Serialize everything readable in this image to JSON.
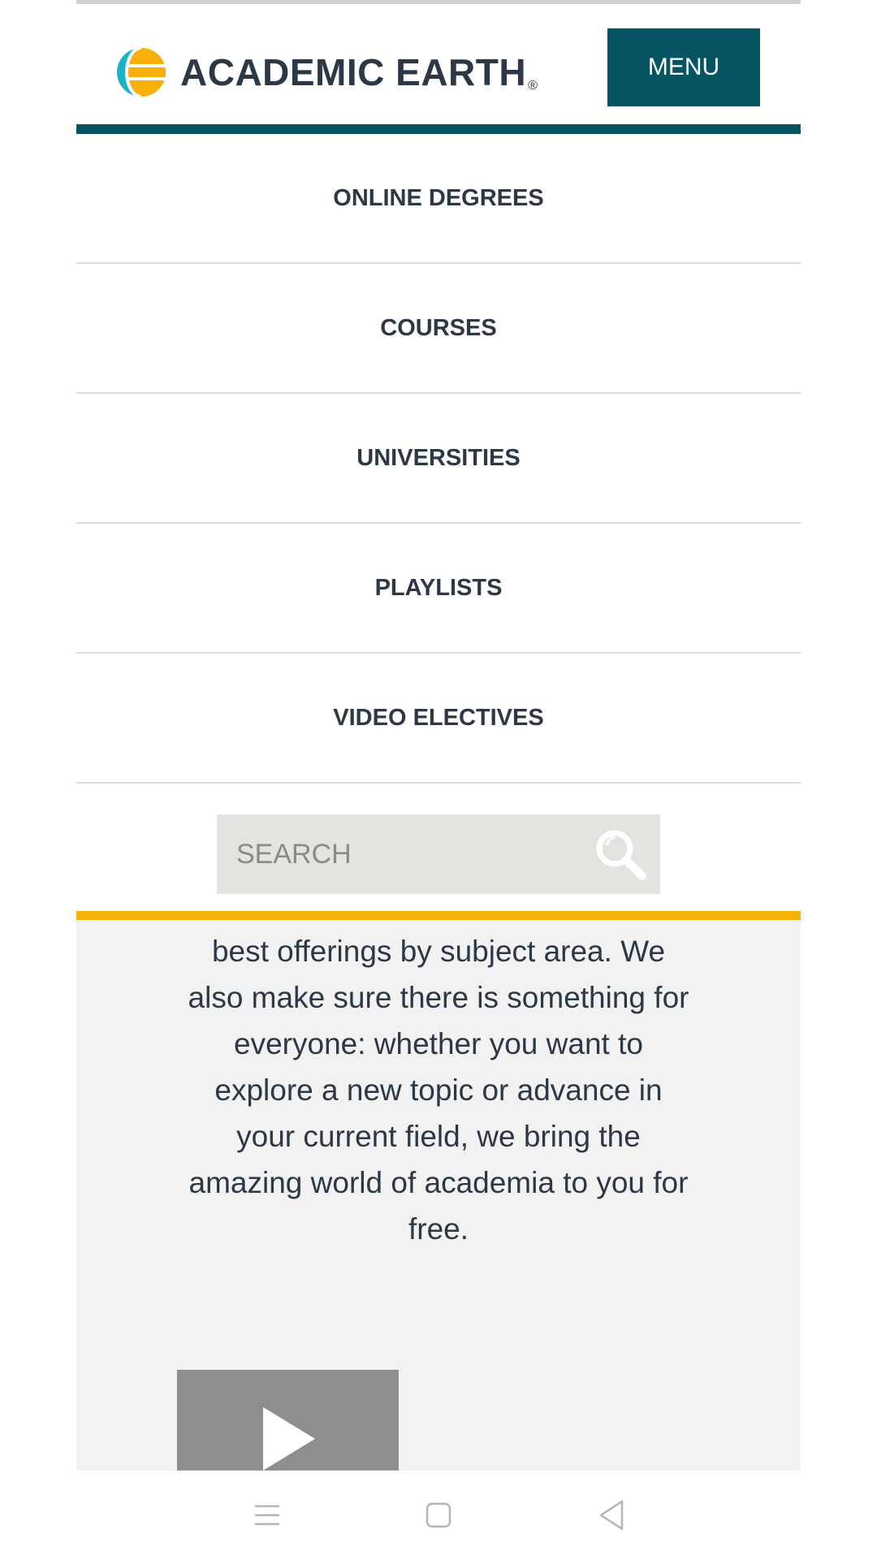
{
  "brand": {
    "name": "ACADEMIC EARTH",
    "reg_mark": "®",
    "colors": {
      "teal": "#065362",
      "yellow": "#f8b00b",
      "cyan": "#1bb3c9"
    }
  },
  "header": {
    "menu_label": "MENU"
  },
  "nav": {
    "items": [
      {
        "label": "ONLINE DEGREES"
      },
      {
        "label": "COURSES"
      },
      {
        "label": "UNIVERSITIES"
      },
      {
        "label": "PLAYLISTS"
      },
      {
        "label": "VIDEO ELECTIVES"
      }
    ]
  },
  "search": {
    "placeholder": "SEARCH",
    "icon": "search-icon"
  },
  "content": {
    "paragraph": "best offerings by subject area. We also make sure there is something for everyone: whether you want to explore a new topic or advance in your current field, we bring the amazing world of academia to you for free."
  },
  "video": {
    "icon": "play-icon"
  },
  "system_nav": {
    "icons": [
      "recent-apps-icon",
      "home-icon",
      "back-icon"
    ]
  }
}
